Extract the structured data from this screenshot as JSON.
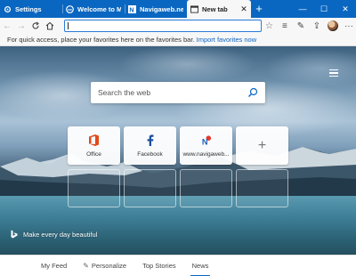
{
  "tabs": [
    {
      "title": "Settings",
      "icon": "gear-icon",
      "active": false
    },
    {
      "title": "Welcome to M",
      "icon": "edge-icon",
      "active": false
    },
    {
      "title": "Navigaweb.ne",
      "icon": "navigaweb-icon",
      "active": false
    },
    {
      "title": "New tab",
      "icon": "newtab-icon",
      "active": true
    }
  ],
  "new_tab_label": "+",
  "address_bar": {
    "value": ""
  },
  "favorites_bar": {
    "message": "For quick access, place your favorites here on the favorites bar. ",
    "link": "Import favorites now"
  },
  "search": {
    "placeholder": "Search the web"
  },
  "top_sites": [
    {
      "label": "Office",
      "icon": "office-icon"
    },
    {
      "label": "Facebook",
      "icon": "facebook-icon"
    },
    {
      "label": "www.navigaweb...",
      "icon": "navigaweb-icon"
    },
    {
      "label": "",
      "icon": "plus-icon"
    }
  ],
  "bing_caption": "Make every day beautiful",
  "bottom_nav": [
    {
      "label": "My Feed",
      "icon": ""
    },
    {
      "label": "Personalize",
      "icon": "pencil-icon"
    },
    {
      "label": "Top Stories",
      "icon": ""
    },
    {
      "label": "News",
      "icon": ""
    }
  ],
  "colors": {
    "accent": "#0a67c1",
    "titlebar": "#0a67c1"
  }
}
